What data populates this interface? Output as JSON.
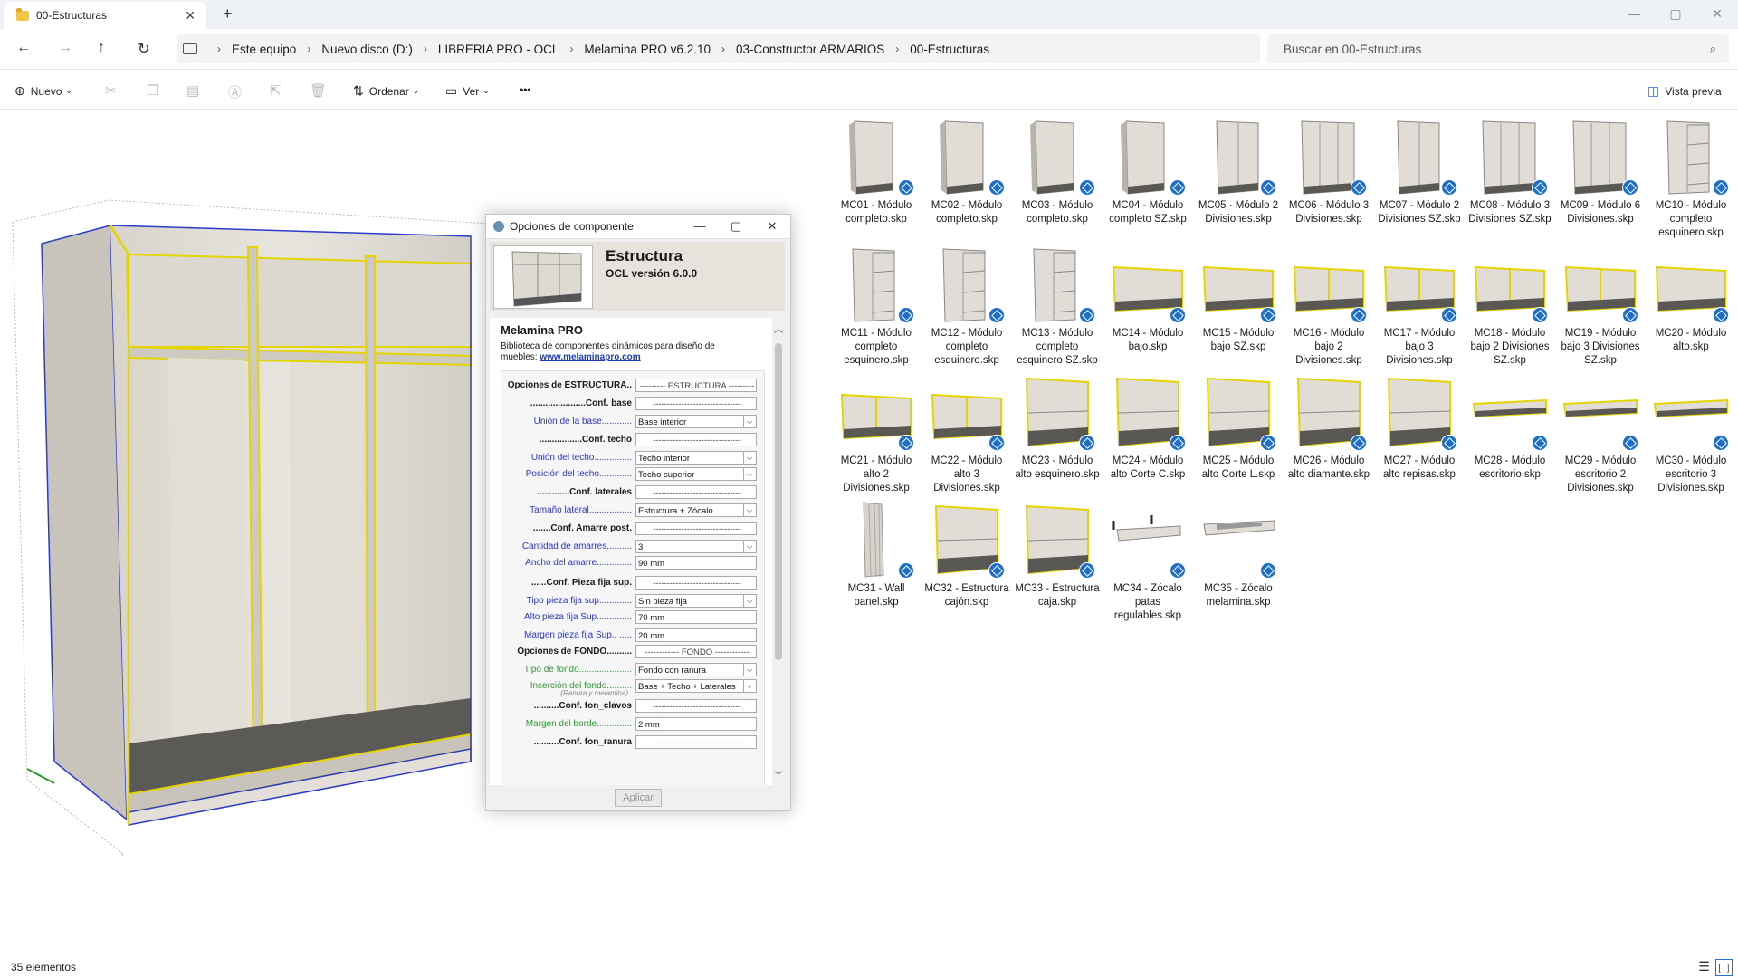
{
  "tab": {
    "title": "00-Estructuras",
    "close": "✕",
    "new": "+"
  },
  "window_controls": {
    "minimize": "—",
    "maximize": "▢",
    "close": "✕"
  },
  "nav": {
    "back": "←",
    "forward": "→",
    "up": "↑",
    "refresh": "↻"
  },
  "breadcrumbs": [
    "Este equipo",
    "Nuevo disco (D:)",
    "LIBRERIA PRO - OCL",
    "Melamina PRO v6.2.10",
    "03-Constructor ARMARIOS",
    "00-Estructuras"
  ],
  "search": {
    "placeholder": "Buscar en 00-Estructuras"
  },
  "commands": {
    "new": "Nuevo",
    "sort": "Ordenar",
    "view": "Ver",
    "more": "•••",
    "preview": "Vista previa"
  },
  "status": {
    "count": "35 elementos"
  },
  "dialog": {
    "title": "Opciones de componente",
    "heading": "Estructura",
    "version": "OCL versión 6.0.0",
    "brand": "Melamina PRO",
    "description": "Biblioteca de componentes dinámicos para diseño de muebles:",
    "link": "www.melaminapro.com",
    "apply": "Aplicar",
    "rows": [
      {
        "label": "Opciones de ESTRUCTURA..",
        "style": "h",
        "value": "--------- ESTRUCTURA ---------",
        "kind": "c"
      },
      {
        "label": "......................Conf. base",
        "style": "h",
        "value": "-------------------------------",
        "kind": "c"
      },
      {
        "label": "Unión de la base............",
        "style": "b",
        "value": "Base interior",
        "kind": "sel"
      },
      {
        "label": ".................Conf. techo",
        "style": "h",
        "value": "-------------------------------",
        "kind": "c"
      },
      {
        "label": "Unión del techo...............",
        "style": "b",
        "value": "Techo interior",
        "kind": "sel"
      },
      {
        "label": "Posición del techo.............",
        "style": "b",
        "value": "Techo superior",
        "kind": "sel"
      },
      {
        "label": ".............Conf. laterales",
        "style": "h",
        "value": "-------------------------------",
        "kind": "c"
      },
      {
        "label": "Tamaño lateral.................",
        "style": "b",
        "value": "Estructura + Zócalo",
        "kind": "sel"
      },
      {
        "label": ".......Conf. Amarre post.",
        "style": "h",
        "value": "-------------------------------",
        "kind": "c"
      },
      {
        "label": "Cantidad de amarres..........",
        "style": "b",
        "value": "3",
        "kind": "sel"
      },
      {
        "label": "Ancho del amarre..............",
        "style": "b",
        "value": "90 mm",
        "kind": "txt"
      },
      {
        "label": "......Conf. Pieza fija sup.",
        "style": "h",
        "value": "-------------------------------",
        "kind": "c"
      },
      {
        "label": "Tipo pieza fija sup.............",
        "style": "b",
        "value": "Sin pieza fija",
        "kind": "sel"
      },
      {
        "label": "Alto pieza fija Sup..............",
        "style": "b",
        "value": "70 mm",
        "kind": "txt"
      },
      {
        "label": "Margen pieza fija Sup.. .....",
        "style": "b",
        "value": "20 mm",
        "kind": "txt"
      },
      {
        "label": "Opciones de FONDO..........",
        "style": "h",
        "value": "------------ FONDO ------------",
        "kind": "c"
      },
      {
        "label": "Tipo de fondo.....................",
        "style": "g",
        "value": "Fondo con ranura",
        "kind": "sel"
      },
      {
        "label": "Inserción del fondo..........",
        "style": "g",
        "value": "Base + Techo + Laterales",
        "kind": "sel"
      },
      {
        "label": "..........Conf. fon_clavos",
        "style": "h",
        "value": "-------------------------------",
        "kind": "c"
      },
      {
        "label": "Margen del borde..............",
        "style": "g",
        "value": "2 mm",
        "kind": "txt"
      },
      {
        "label": "..........Conf. fon_ranura",
        "style": "h",
        "value": "-------------------------------",
        "kind": "c"
      }
    ],
    "note": "(Ranura y melamina)"
  },
  "files": [
    {
      "name": "MC01 - Módulo completo.skp",
      "kind": "tall"
    },
    {
      "name": "MC02 - Módulo completo.skp",
      "kind": "tall"
    },
    {
      "name": "MC03 - Módulo completo.skp",
      "kind": "tall"
    },
    {
      "name": "MC04 - Módulo completo SZ.skp",
      "kind": "tall"
    },
    {
      "name": "MC05 - Módulo 2 Divisiones.skp",
      "kind": "tall2"
    },
    {
      "name": "MC06 - Módulo 3 Divisiones.skp",
      "kind": "tall3"
    },
    {
      "name": "MC07 - Módulo 2 Divisiones SZ.skp",
      "kind": "tall2"
    },
    {
      "name": "MC08 - Módulo 3 Divisiones SZ.skp",
      "kind": "tall3"
    },
    {
      "name": "MC09 - Módulo 6 Divisiones.skp",
      "kind": "tall3"
    },
    {
      "name": "MC10 - Módulo completo esquinero.skp",
      "kind": "corner"
    },
    {
      "name": "MC11 - Módulo completo esquinero.skp",
      "kind": "corner"
    },
    {
      "name": "MC12 - Módulo completo esquinero.skp",
      "kind": "corner"
    },
    {
      "name": "MC13 - Módulo completo esquinero SZ.skp",
      "kind": "corner"
    },
    {
      "name": "MC14 - Módulo bajo.skp",
      "kind": "low"
    },
    {
      "name": "MC15 - Módulo bajo SZ.skp",
      "kind": "low"
    },
    {
      "name": "MC16 - Módulo bajo 2 Divisiones.skp",
      "kind": "low2"
    },
    {
      "name": "MC17 - Módulo bajo 3 Divisiones.skp",
      "kind": "low2"
    },
    {
      "name": "MC18 - Módulo bajo 2 Divisiones SZ.skp",
      "kind": "low2"
    },
    {
      "name": "MC19 - Módulo bajo 3 Divisiones SZ.skp",
      "kind": "low2"
    },
    {
      "name": "MC20 - Módulo alto.skp",
      "kind": "low"
    },
    {
      "name": "MC21 - Módulo alto 2 Divisiones.skp",
      "kind": "low2"
    },
    {
      "name": "MC22 - Módulo alto 3 Divisiones.skp",
      "kind": "low2"
    },
    {
      "name": "MC23 - Módulo alto esquinero.skp",
      "kind": "box"
    },
    {
      "name": "MC24 - Módulo alto Corte C.skp",
      "kind": "box"
    },
    {
      "name": "MC25 - Módulo alto Corte L.skp",
      "kind": "box"
    },
    {
      "name": "MC26 - Módulo alto diamante.skp",
      "kind": "box"
    },
    {
      "name": "MC27 - Módulo alto repisas.skp",
      "kind": "box"
    },
    {
      "name": "MC28 - Módulo escritorio.skp",
      "kind": "flat"
    },
    {
      "name": "MC29 - Módulo escritorio 2 Divisiones.skp",
      "kind": "flat"
    },
    {
      "name": "MC30 - Módulo escritorio 3 Divisiones.skp",
      "kind": "flat"
    },
    {
      "name": "MC31 - Wall panel.skp",
      "kind": "panel"
    },
    {
      "name": "MC32 - Estructura cajón.skp",
      "kind": "box"
    },
    {
      "name": "MC33 - Estructura caja.skp",
      "kind": "box"
    },
    {
      "name": "MC34 - Zócalo patas regulables.skp",
      "kind": "plinth"
    },
    {
      "name": "MC35 - Zócalo melamina.skp",
      "kind": "plinth2"
    }
  ]
}
